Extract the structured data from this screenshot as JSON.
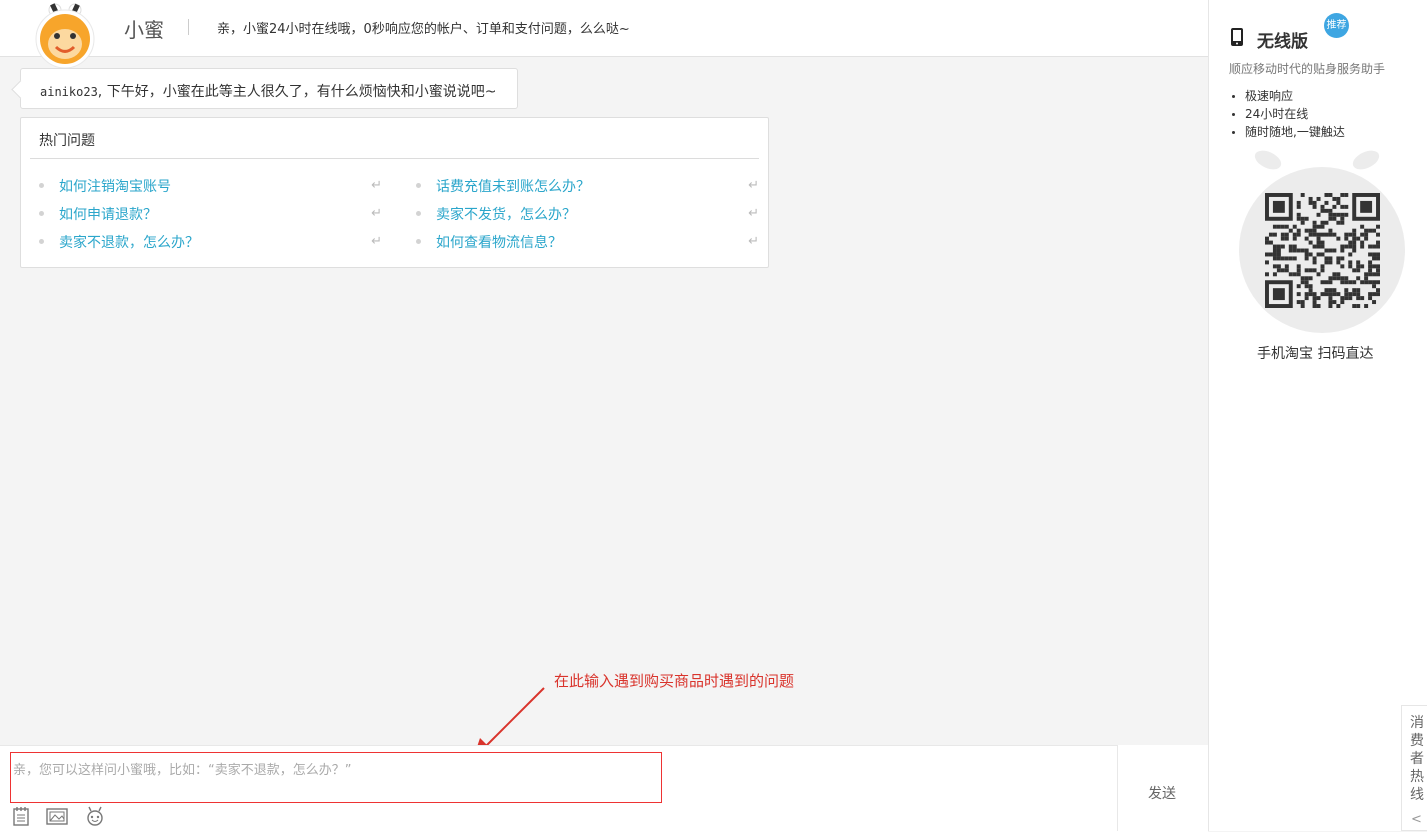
{
  "header": {
    "assistant_name": "小蜜",
    "slogan": "亲，小蜜24小时在线哦，0秒响应您的帐户、订单和支付问题，么么哒~"
  },
  "chat": {
    "greeting_user": "ainiko23",
    "greeting_text": ", 下午好，小蜜在此等主人很久了，有什么烦恼快和小蜜说说吧~"
  },
  "hot_questions": {
    "title": "热门问题",
    "left": [
      "如何注销淘宝账号",
      "如何申请退款？",
      "卖家不退款，怎么办？"
    ],
    "right": [
      "话费充值未到账怎么办？",
      "卖家不发货，怎么办？",
      "如何查看物流信息？"
    ],
    "enter_icon": "↵"
  },
  "annotation": {
    "text": "在此输入遇到购买商品时遇到的问题",
    "color": "#d9342c"
  },
  "input": {
    "placeholder": "亲，您可以这样问小蜜哦，比如：“卖家不退款，怎么办？”",
    "value": "",
    "send_label": "发送",
    "toolbar_icons": [
      "notepad-icon",
      "image-icon",
      "robot-face-icon"
    ]
  },
  "side_panel": {
    "title": "无线版",
    "badge": "推荐",
    "subtitle": "顺应移动时代的贴身服务助手",
    "features": [
      "极速响应",
      "24小时在线",
      "随时随地,一键触达"
    ],
    "qr_caption": "手机淘宝  扫码直达",
    "hotline_label": "消费者热线",
    "hotline_arrow": "<"
  },
  "colors": {
    "accent": "#2ba6cb",
    "badge": "#3ea6e2",
    "input_border": "#ee3333",
    "logo_orange": "#f7a52b"
  }
}
